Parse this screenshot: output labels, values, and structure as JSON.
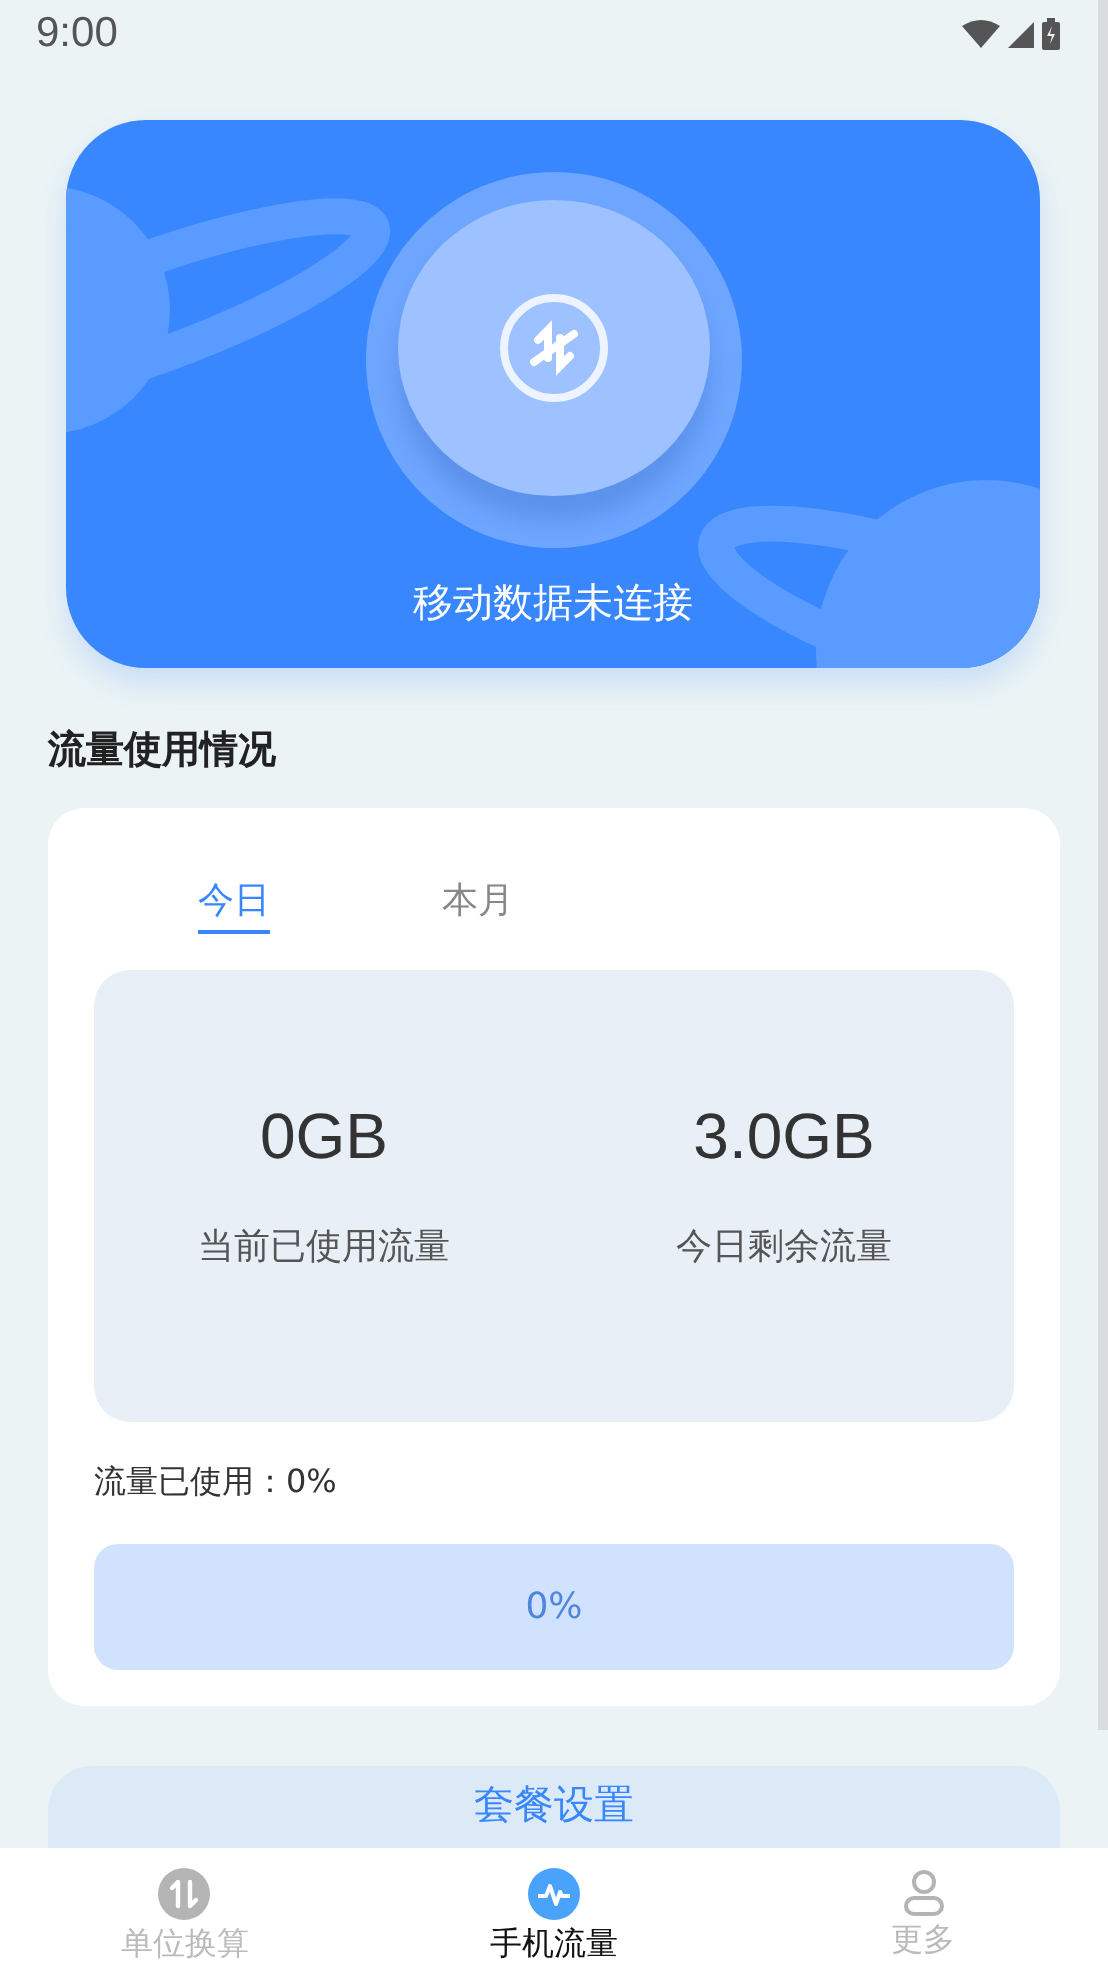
{
  "status_bar": {
    "time": "9:00"
  },
  "connection": {
    "status": "移动数据未连接"
  },
  "section_title": "流量使用情况",
  "usage_card": {
    "tabs": [
      {
        "label": "今日",
        "selected": true
      },
      {
        "label": "本月",
        "selected": false
      }
    ],
    "stats": [
      {
        "value": "0GB",
        "label": "当前已使用流量"
      },
      {
        "value": "3.0GB",
        "label": "今日剩余流量"
      }
    ],
    "used_label": "流量已使用：0%",
    "progress": {
      "level": 0,
      "reading": "0%"
    }
  },
  "plan_button": "套餐设置",
  "bottom_nav": [
    {
      "label": "单位换算",
      "selected": false,
      "kind": "convert"
    },
    {
      "label": "手机流量",
      "selected": true,
      "kind": "traffic"
    },
    {
      "label": "更多",
      "selected": false,
      "kind": "more"
    }
  ]
}
